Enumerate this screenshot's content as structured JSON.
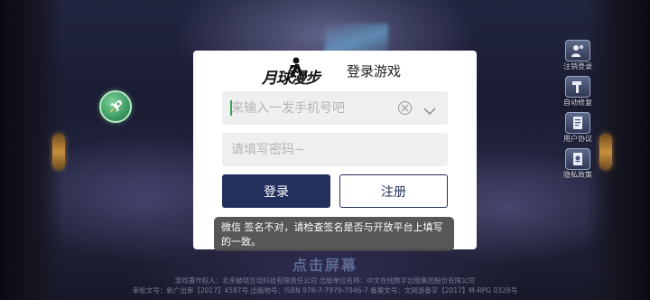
{
  "login_dialog": {
    "logo_text": "月球漫步",
    "title": "登录游戏",
    "phone_field": {
      "placeholder": "来输入一发手机号吧",
      "value": ""
    },
    "password_field": {
      "placeholder": "请填写密码~",
      "value": ""
    },
    "login_button": "登录",
    "register_button": "注册"
  },
  "toast": {
    "message": "微信  签名不对，请检查签名是否与开放平台上填写的一致。"
  },
  "side_menu": {
    "items": [
      {
        "label": "注销登录",
        "icon": "user-logout-icon"
      },
      {
        "label": "自动修复",
        "icon": "hammer-repair-icon"
      },
      {
        "label": "用户协议",
        "icon": "document-icon"
      },
      {
        "label": "隐私政策",
        "icon": "privacy-icon"
      }
    ]
  },
  "tap_screen": "点击屏幕",
  "copyright": {
    "line1": "游戏著作权人：北京破晓互动科技有限责任公司  出版单位名称：中文在线数字出版集团股份有限公司",
    "line2": "审批文号：新广出审【2017】4587号  出版物号：ISBN 978-7-7979-7946-7  备案文号：文网游备字【2017】M-RPG 0328号"
  },
  "colors": {
    "primary_button": "#23305e",
    "toast_bg": "#4a4a4a",
    "input_bg": "#efefef",
    "caret": "#34a853"
  }
}
